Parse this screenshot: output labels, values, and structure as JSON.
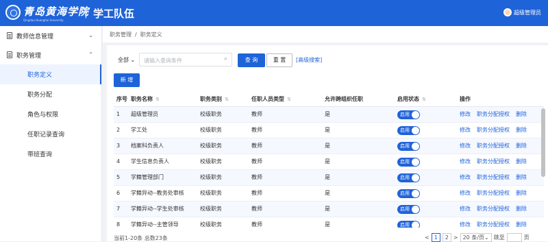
{
  "header": {
    "logo_cn": "青岛黄海学院",
    "logo_en": "Qingdao Huanghai University",
    "separator": "|",
    "system_title": "学工队伍",
    "user_name": "超级管理员"
  },
  "sidebar": {
    "groups": [
      {
        "label": "教师信息管理",
        "chevron": "⌄"
      },
      {
        "label": "职务管理",
        "chevron": "⌃"
      }
    ],
    "items": [
      {
        "label": "职务定义"
      },
      {
        "label": "职务分配"
      },
      {
        "label": "角色与权限"
      },
      {
        "label": "任职记录查询"
      },
      {
        "label": "带班查询"
      }
    ]
  },
  "breadcrumb": {
    "parent": "职务管理",
    "sep": "/",
    "current": "职务定义"
  },
  "toolbar": {
    "scope": "全部",
    "scope_arrow": "⌄",
    "search_placeholder": "请输入查询条件",
    "query": "查 询",
    "reset": "重 置",
    "advanced": "[高级搜索]",
    "add": "新 增"
  },
  "table": {
    "headers": [
      "序号",
      "职务名称",
      "职务类别",
      "任职人员类型",
      "允许跨组织任职",
      "启用状态",
      "操作"
    ],
    "rows": [
      {
        "no": "1",
        "name": "超级管理员",
        "category": "校级职务",
        "type": "教师",
        "cross": "是",
        "status": "启用"
      },
      {
        "no": "2",
        "name": "学工处",
        "category": "校级职务",
        "type": "教师",
        "cross": "是",
        "status": "启用"
      },
      {
        "no": "3",
        "name": "档案科负责人",
        "category": "校级职务",
        "type": "教师",
        "cross": "是",
        "status": "启用"
      },
      {
        "no": "4",
        "name": "学生信息负责人",
        "category": "校级职务",
        "type": "教师",
        "cross": "是",
        "status": "启用"
      },
      {
        "no": "5",
        "name": "学籍管理部门",
        "category": "校级职务",
        "type": "教师",
        "cross": "是",
        "status": "启用"
      },
      {
        "no": "6",
        "name": "学籍异动--教务处审核",
        "category": "校级职务",
        "type": "教师",
        "cross": "是",
        "status": "启用"
      },
      {
        "no": "7",
        "name": "学籍异动--学生处审核",
        "category": "校级职务",
        "type": "教师",
        "cross": "是",
        "status": "启用"
      },
      {
        "no": "8",
        "name": "学籍异动--主管领导",
        "category": "校级职务",
        "type": "教师",
        "cross": "是",
        "status": "启用"
      }
    ],
    "actions": {
      "edit": "修改",
      "grant": "职务分配授权",
      "delete": "删除"
    }
  },
  "footer": {
    "summary": "当前1-20条 总数23条"
  },
  "pager": {
    "prev": "<",
    "page1": "1",
    "page2": "2",
    "next": ">",
    "size": "20 条/页",
    "size_arrow": "⌄",
    "goto": "跳至",
    "page_unit": "页"
  }
}
